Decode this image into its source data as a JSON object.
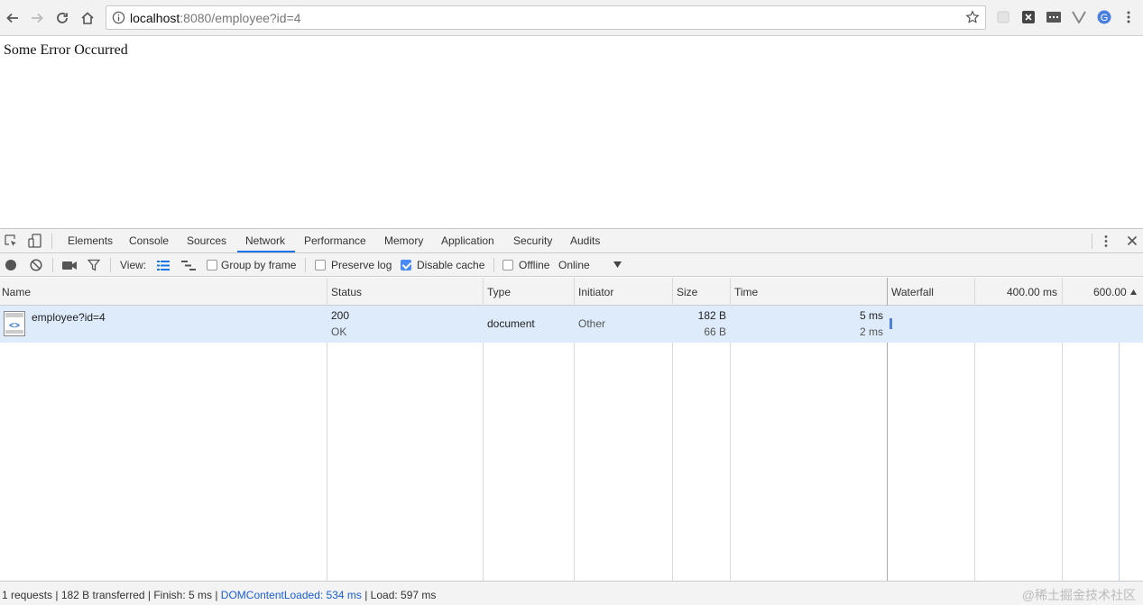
{
  "browser": {
    "url_host": "localhost",
    "url_rest": ":8080/employee?id=4"
  },
  "page": {
    "error_text": "Some Error Occurred"
  },
  "devtools": {
    "tabs": [
      "Elements",
      "Console",
      "Sources",
      "Network",
      "Performance",
      "Memory",
      "Application",
      "Security",
      "Audits"
    ],
    "active_tab": "Network",
    "toolbar": {
      "view_label": "View:",
      "group_by_frame": "Group by frame",
      "preserve_log": "Preserve log",
      "disable_cache": "Disable cache",
      "offline": "Offline",
      "throttle": "Online",
      "group_by_frame_checked": false,
      "preserve_log_checked": false,
      "disable_cache_checked": true,
      "offline_checked": false
    },
    "columns": {
      "name": "Name",
      "status": "Status",
      "type": "Type",
      "initiator": "Initiator",
      "size": "Size",
      "time": "Time",
      "waterfall": "Waterfall",
      "wf_tick1": "400.00 ms",
      "wf_tick2": "600.00"
    },
    "requests": [
      {
        "name": "employee?id=4",
        "status_code": "200",
        "status_text": "OK",
        "type": "document",
        "initiator": "Other",
        "size": "182 B",
        "content": "66 B",
        "time": "5 ms",
        "latency": "2 ms"
      }
    ],
    "summary": {
      "prefix": "1 requests | 182 B transferred | Finish: 5 ms | ",
      "dom_loaded": "DOMContentLoaded: 534 ms",
      "suffix": " | Load: 597 ms"
    },
    "watermark": "@稀土掘金技术社区"
  }
}
